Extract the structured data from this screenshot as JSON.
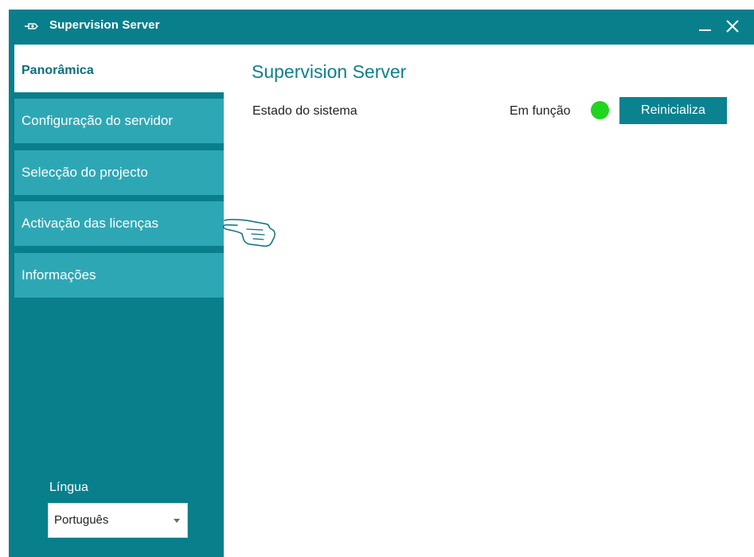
{
  "window": {
    "title": "Supervision Server",
    "accent_color": "#097f8c",
    "controls": {
      "minimize_icon": "minimize-icon",
      "close_icon": "close-icon"
    }
  },
  "sidebar": {
    "items": [
      {
        "label": "Panorâmica",
        "active": true
      },
      {
        "label": "Configuração do servidor",
        "active": false
      },
      {
        "label": "Selecção do projecto",
        "active": false
      },
      {
        "label": "Activação das licenças",
        "active": false
      },
      {
        "label": "Informações",
        "active": false
      }
    ],
    "language": {
      "label": "Língua",
      "selected": "Português"
    }
  },
  "main": {
    "title": "Supervision Server",
    "system_status": {
      "label": "Estado do sistema",
      "value": "Em função",
      "indicator_color": "#1fd51f",
      "restart_label": "Reinicializa"
    }
  },
  "cursor": {
    "icon": "pointing-hand-cursor-icon"
  }
}
